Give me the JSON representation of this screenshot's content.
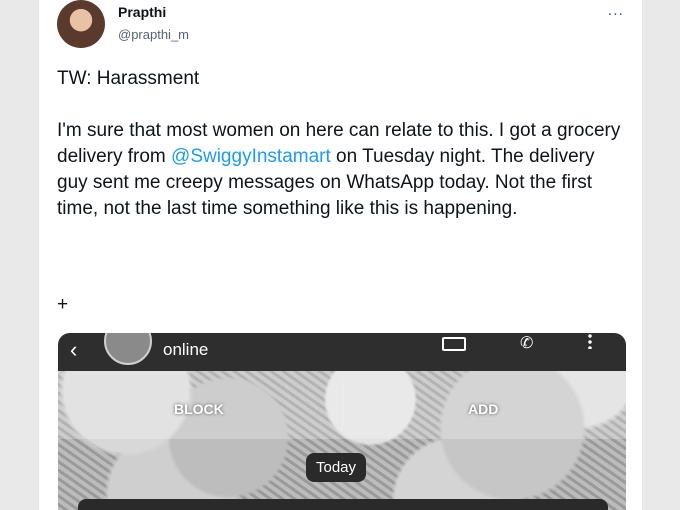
{
  "tweet": {
    "author_name": "Prapthi",
    "author_handle": "@prapthi_m",
    "more_icon": "...",
    "tw_line": "TW: Harassment",
    "body_part1": "I'm sure that most women on here can relate to this. I got a grocery delivery from ",
    "mention": "@SwiggyInstamart",
    "body_part2": " on Tuesday night. The delivery guy sent me creepy messages on WhatsApp today. Not the first time, not the last time something like this is happening.",
    "plus": "+"
  },
  "screenshot": {
    "status": "online",
    "block_label": "BLOCK",
    "add_label": "ADD",
    "date_chip": "Today",
    "back_icon": "‹",
    "call_icon": "✆"
  },
  "colors": {
    "mention": "#1d9bf0",
    "text": "#0f1419",
    "secondary": "#536471",
    "wa_header": "#2e2e2e"
  }
}
